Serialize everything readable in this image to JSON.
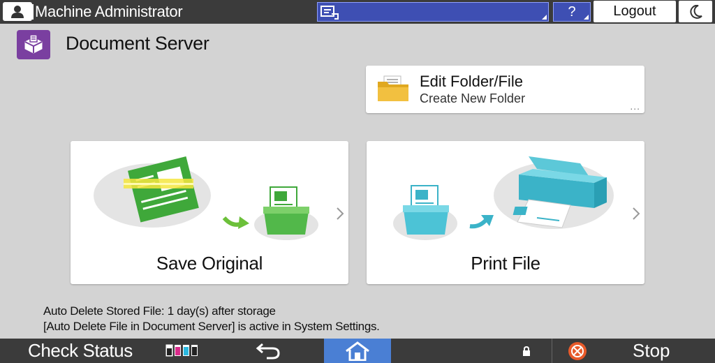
{
  "topbar": {
    "user_name": "Machine Administrator",
    "help_label": "?",
    "logout_label": "Logout"
  },
  "header": {
    "title": "Document Server"
  },
  "edit_folder": {
    "title": "Edit Folder/File",
    "subtitle": "Create New Folder",
    "more": "..."
  },
  "cards": {
    "save_label": "Save Original",
    "print_label": "Print File"
  },
  "notes": {
    "line1": "Auto Delete Stored File: 1 day(s) after storage",
    "line2": "[Auto Delete File in Document Server] is active in System Settings."
  },
  "bottombar": {
    "check_status_label": "Check Status",
    "stop_label": "Stop"
  },
  "colors": {
    "bar_bg": "#3b3b3b",
    "job_bg": "#3e4fb3",
    "home_bg": "#4a7fd4",
    "app_icon_bg": "#7a3fa0",
    "stop_red": "#e85a2a"
  },
  "icons": {
    "user": "user-icon",
    "job": "job-list-icon",
    "moon": "moon-icon",
    "app": "document-server-icon",
    "folder": "folder-icon",
    "back": "back-arrow-icon",
    "home": "home-icon",
    "lock": "lock-icon",
    "stop": "stop-icon",
    "toner": "toner-icon"
  }
}
